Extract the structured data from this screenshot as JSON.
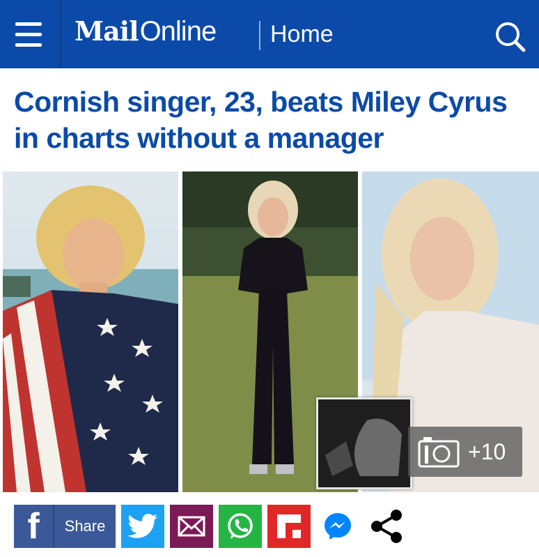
{
  "header": {
    "logo_bold": "Mail",
    "logo_light": "Online",
    "section": "Home",
    "menu_icon": "hamburger-menu-icon",
    "search_icon": "search-icon",
    "bg_color": "#0b4aa8"
  },
  "article": {
    "headline": "Cornish singer, 23, beats Miley Cyrus in charts without a manager",
    "headline_color": "#0b4aa8"
  },
  "gallery": {
    "count": "+10",
    "camera_icon": "camera-icon",
    "photos": [
      "photo-flag-wrap",
      "photo-black-outfit-field",
      "photo-knit-sweater-beach"
    ],
    "thumbnail": "photo-thumbnail-performance"
  },
  "share": {
    "facebook_label": "Share",
    "buttons": [
      {
        "name": "facebook",
        "color": "#3b5998"
      },
      {
        "name": "twitter",
        "color": "#1da1f2"
      },
      {
        "name": "email",
        "color": "#7b1a57"
      },
      {
        "name": "whatsapp",
        "color": "#25b545"
      },
      {
        "name": "flipboard",
        "color": "#e12828"
      },
      {
        "name": "messenger",
        "color": "#0084ff"
      },
      {
        "name": "share",
        "color": "#000000"
      }
    ]
  }
}
